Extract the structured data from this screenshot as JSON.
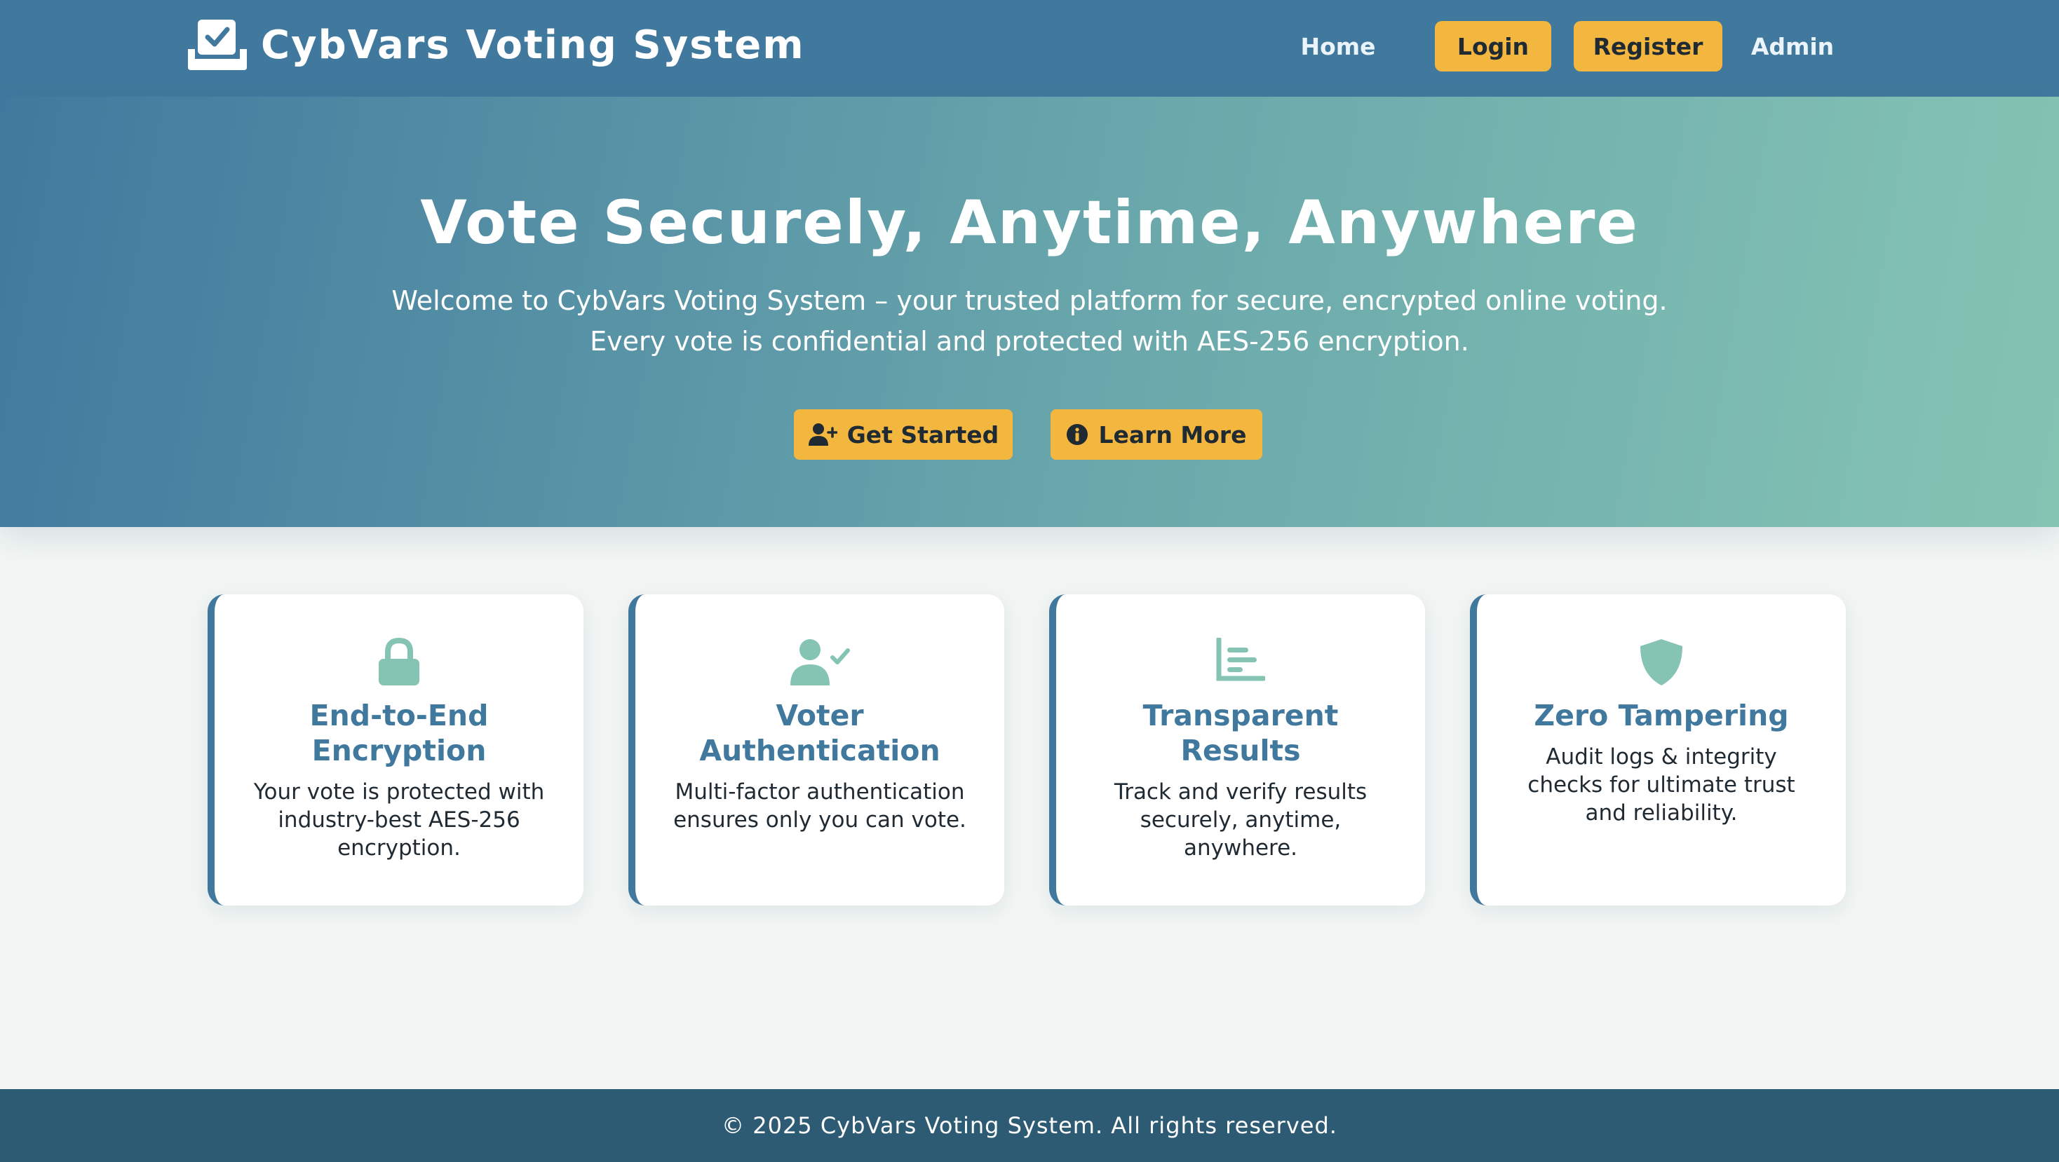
{
  "header": {
    "brand_title": "CybVars Voting System",
    "brand_icon": "ballot-check-icon",
    "nav": {
      "home": "Home",
      "login": "Login",
      "register": "Register",
      "admin": "Admin"
    }
  },
  "hero": {
    "title": "Vote Securely, Anytime, Anywhere",
    "subtitle_line1": "Welcome to CybVars Voting System – your trusted platform for secure, encrypted online voting.",
    "subtitle_line2": "Every vote is confidential and protected with AES-256 encryption.",
    "get_started": {
      "label": "Get Started",
      "icon": "user-plus-icon"
    },
    "learn_more": {
      "label": "Learn More",
      "icon": "info-circle-icon"
    }
  },
  "features": [
    {
      "icon": "lock-icon",
      "title": "End-to-End Encryption",
      "text": "Your vote is protected with industry-best AES-256 encryption."
    },
    {
      "icon": "user-check-icon",
      "title": "Voter Authentication",
      "text": "Multi-factor authentication ensures only you can vote."
    },
    {
      "icon": "chart-bar-icon",
      "title": "Transparent Results",
      "text": "Track and verify results securely, anytime, anywhere."
    },
    {
      "icon": "shield-icon",
      "title": "Zero Tampering",
      "text": "Audit logs & integrity checks for ultimate trust and reliability."
    }
  ],
  "footer": {
    "text": "© 2025 CybVars Voting System. All rights reserved."
  },
  "colors": {
    "header_bg": "#41799e",
    "accent_button": "#f3b73f",
    "feature_icon": "#85c4b3",
    "feature_title": "#41799e",
    "footer_bg": "#2e5b74",
    "page_bg": "#f1f5f4"
  }
}
